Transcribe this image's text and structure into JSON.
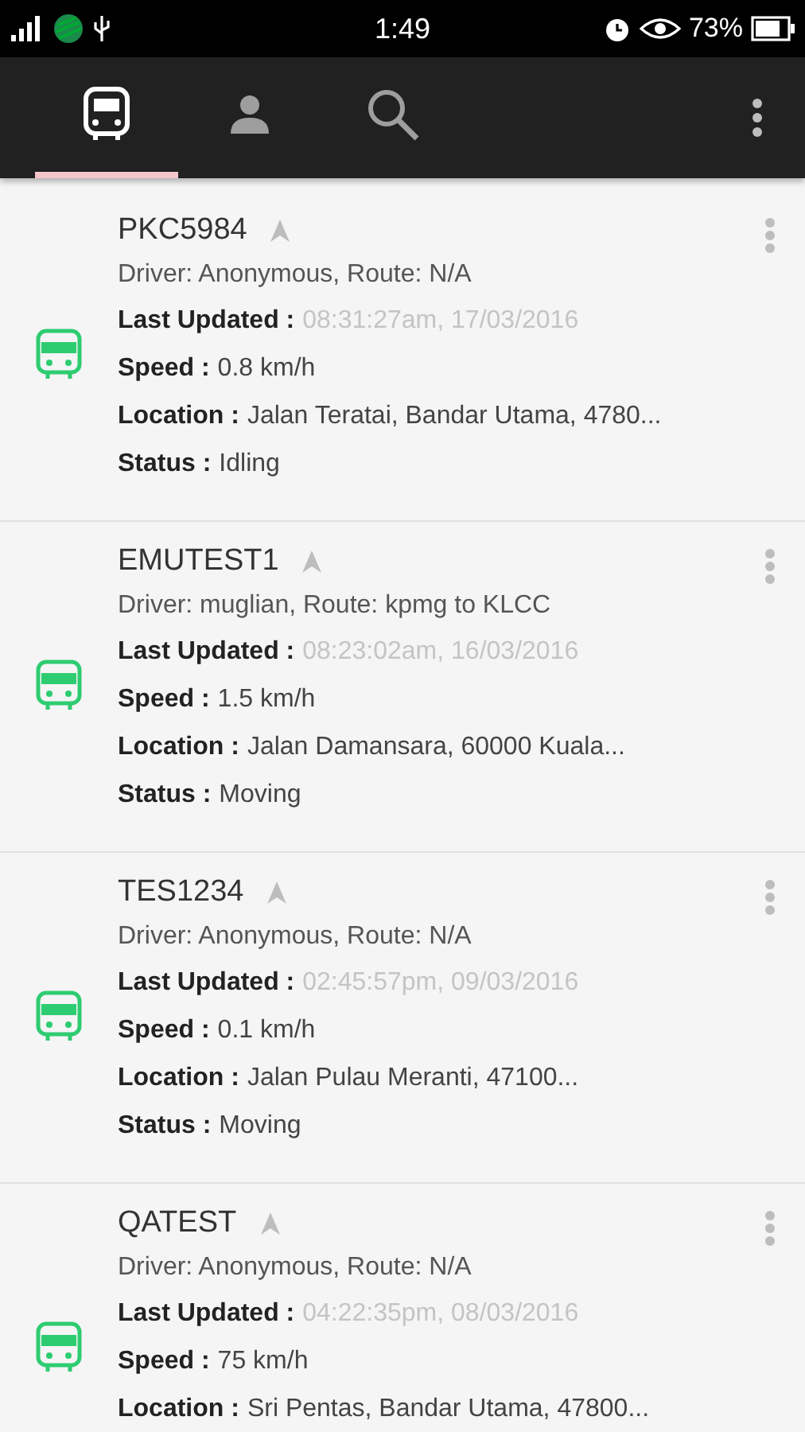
{
  "status_bar": {
    "time": "1:49",
    "battery": "73%"
  },
  "tabs": [
    {
      "kind": "bus",
      "selected": true
    },
    {
      "kind": "person",
      "selected": false
    },
    {
      "kind": "search",
      "selected": false
    }
  ],
  "vehicles": [
    {
      "name": "PKC5984",
      "driver": "Driver: Anonymous, Route: N/A",
      "fields": [
        {
          "kind": "time",
          "label": "Last Updated :",
          "value": "08:31:27am,  17/03/2016"
        },
        {
          "kind": "plain",
          "label": "Speed :",
          "value": "0.8 km/h"
        },
        {
          "kind": "plain",
          "label": "Location :",
          "value": "Jalan Teratai, Bandar Utama, 4780..."
        },
        {
          "kind": "plain",
          "label": "Status :",
          "value": "Idling"
        }
      ]
    },
    {
      "name": "EMUTEST1",
      "driver": "Driver: muglian, Route: kpmg to KLCC",
      "fields": [
        {
          "kind": "time",
          "label": "Last Updated :",
          "value": "08:23:02am,  16/03/2016"
        },
        {
          "kind": "plain",
          "label": "Speed :",
          "value": "1.5 km/h"
        },
        {
          "kind": "plain",
          "label": "Location :",
          "value": "Jalan Damansara, 60000 Kuala..."
        },
        {
          "kind": "plain",
          "label": "Status :",
          "value": "Moving"
        }
      ]
    },
    {
      "name": "TES1234",
      "driver": "Driver: Anonymous, Route: N/A",
      "fields": [
        {
          "kind": "time",
          "label": "Last Updated :",
          "value": "02:45:57pm,  09/03/2016"
        },
        {
          "kind": "plain",
          "label": "Speed :",
          "value": "0.1 km/h"
        },
        {
          "kind": "plain",
          "label": "Location :",
          "value": "Jalan Pulau Meranti, 47100..."
        },
        {
          "kind": "plain",
          "label": "Status :",
          "value": "Moving"
        }
      ]
    },
    {
      "name": "QATEST",
      "driver": "Driver: Anonymous, Route: N/A",
      "fields": [
        {
          "kind": "time",
          "label": "Last Updated :",
          "value": "04:22:35pm,  08/03/2016"
        },
        {
          "kind": "plain",
          "label": "Speed :",
          "value": "75 km/h"
        },
        {
          "kind": "plain",
          "label": "Location :",
          "value": "Sri Pentas, Bandar Utama, 47800..."
        }
      ]
    }
  ]
}
